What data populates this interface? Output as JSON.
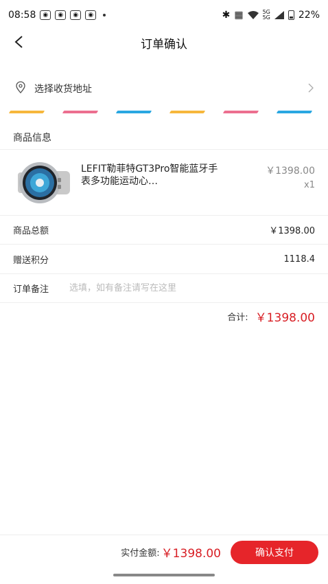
{
  "status_bar": {
    "time": "08:58",
    "battery_text": "22%",
    "signal_text_top": "5G",
    "signal_text_bottom": "5G",
    "notification_icons": [
      "app-notification-icon",
      "app-notification-icon",
      "app-notification-icon",
      "app-notification-icon"
    ]
  },
  "nav": {
    "title": "订单确认"
  },
  "address": {
    "label": "选择收货地址"
  },
  "stripe_colors": [
    "#f6b73c",
    "#ec6f8f",
    "#29a7e1",
    "#f6b73c",
    "#ec6f8f",
    "#29a7e1"
  ],
  "product_section": {
    "title": "商品信息"
  },
  "product": {
    "name": "LEFIT勒菲特GT3Pro智能蓝牙手表多功能运动心…",
    "price": "￥1398.00",
    "quantity": "x1"
  },
  "summary": {
    "subtotal_label": "商品总额",
    "subtotal_value": "￥1398.00",
    "points_label": "赠送积分",
    "points_value": "1118.4",
    "remark_label": "订单备注",
    "remark_placeholder": "选填，如有备注请写在这里",
    "total_label": "合计:",
    "total_value": "￥1398.00"
  },
  "bottom_bar": {
    "pay_label": "实付金额:",
    "pay_amount": "￥1398.00",
    "pay_button": "确认支付"
  },
  "colors": {
    "accent": "#e6252a",
    "price_red": "#d81e24"
  }
}
